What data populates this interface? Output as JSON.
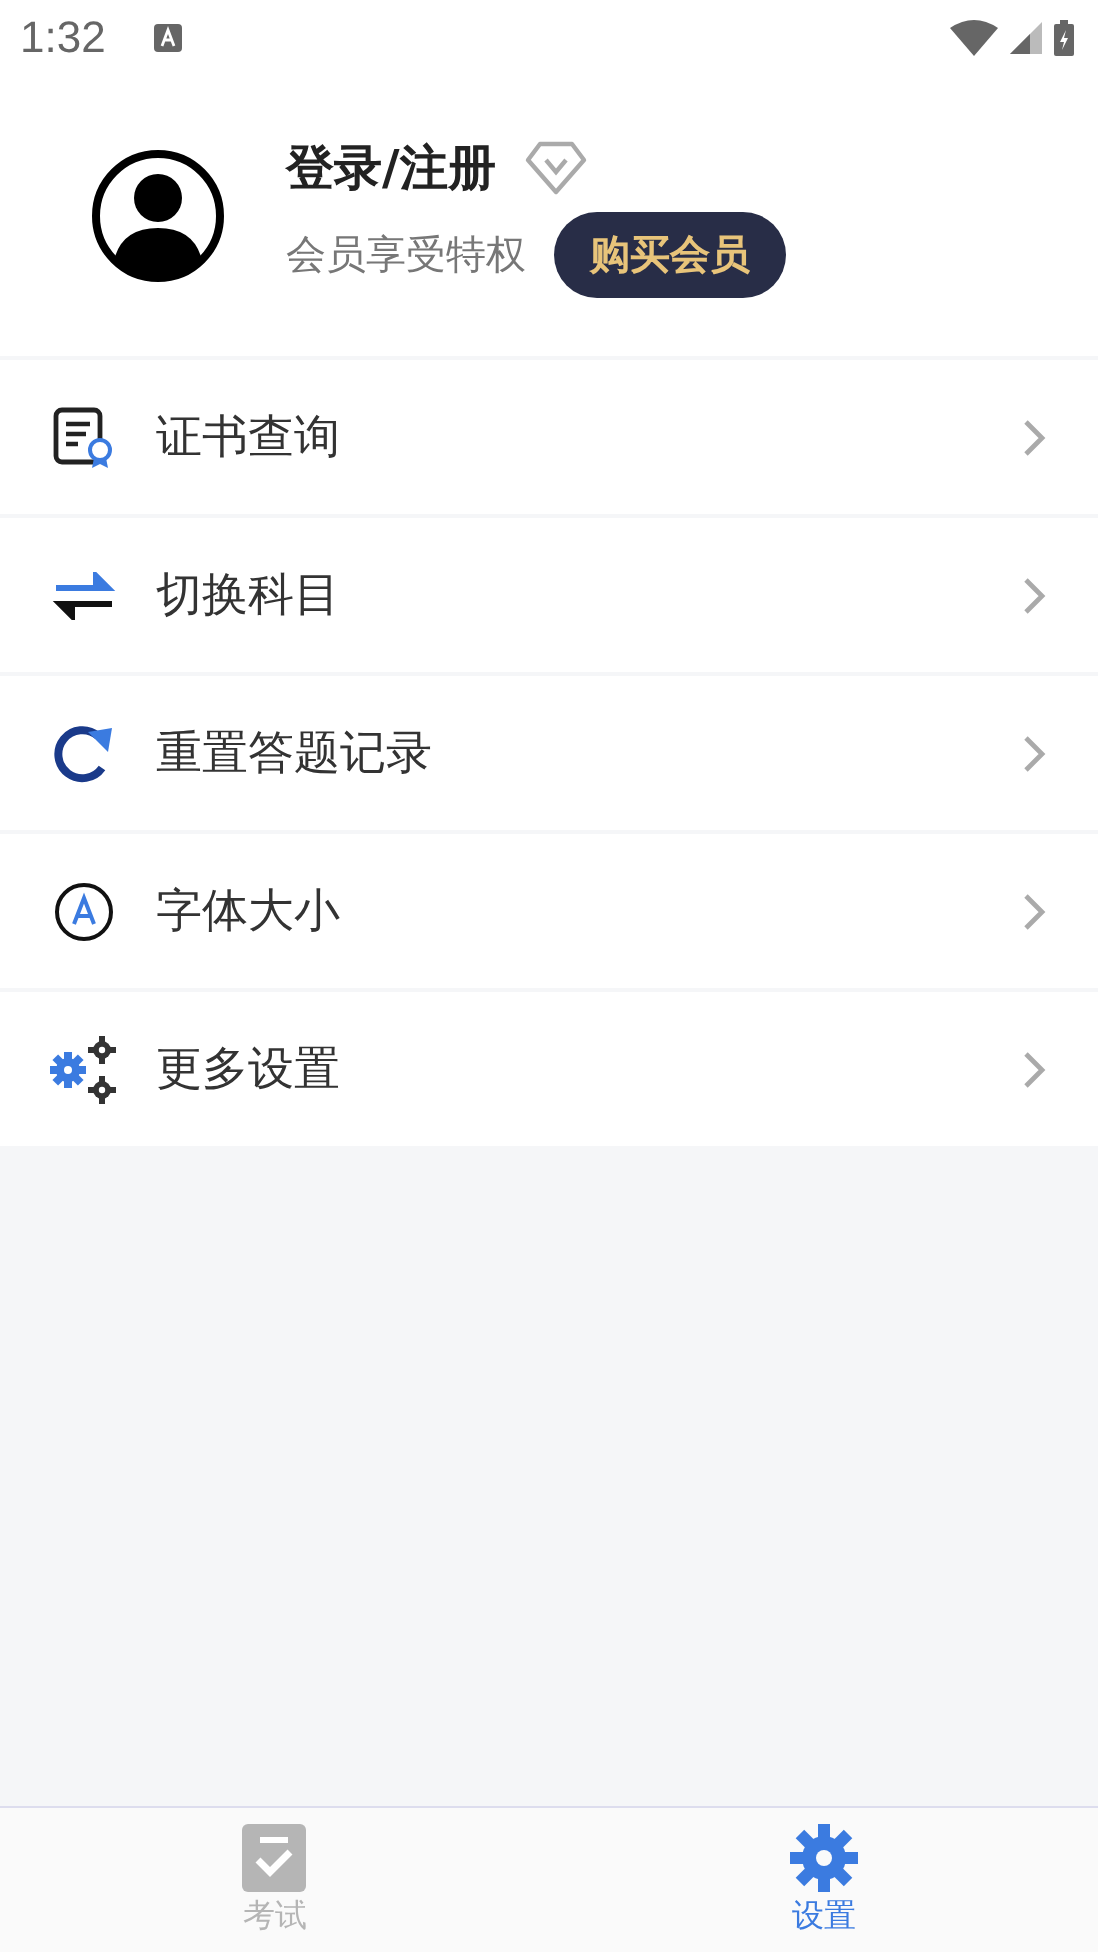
{
  "status_bar": {
    "time": "1:32"
  },
  "profile": {
    "name": "登录/注册",
    "subtitle": "会员享受特权",
    "button": "购买会员"
  },
  "menu": [
    {
      "kind": "certificate",
      "label": "证书查询"
    },
    {
      "kind": "swap",
      "label": "切换科目"
    },
    {
      "kind": "reset",
      "label": "重置答题记录"
    },
    {
      "kind": "font",
      "label": "字体大小"
    },
    {
      "kind": "settings",
      "label": "更多设置"
    }
  ],
  "tabs": [
    {
      "kind": "exam",
      "label": "考试",
      "selected": false
    },
    {
      "kind": "settings",
      "label": "设置",
      "selected": true
    }
  ]
}
